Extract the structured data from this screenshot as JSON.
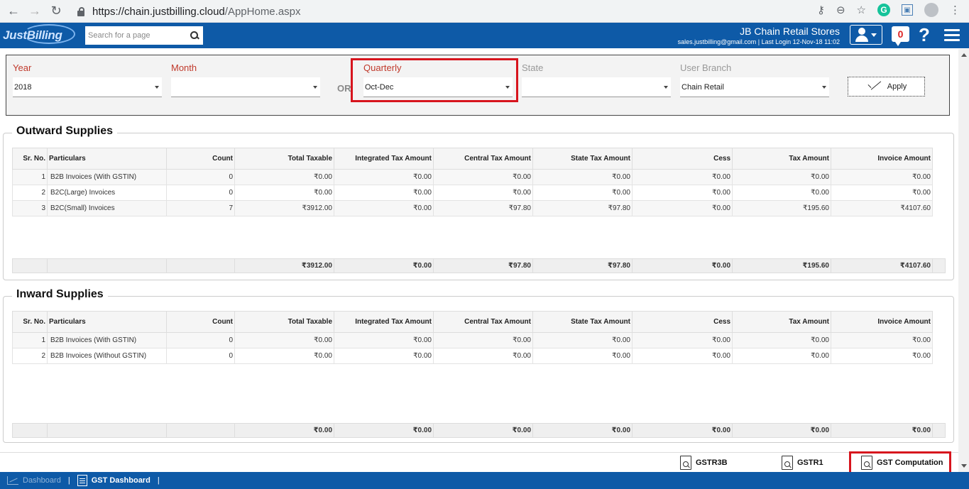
{
  "browser": {
    "url_host": "https://chain.justbilling.cloud",
    "url_path": "/AppHome.aspx"
  },
  "header": {
    "logo": "JustBilling",
    "search_placeholder": "Search for a page",
    "store_name": "JB Chain Retail Stores",
    "store_sub": "sales.justbilling@gmail.com | Last Login 12-Nov-18 11:02",
    "notification_count": "0",
    "help_label": "?"
  },
  "filters": {
    "year": {
      "label": "Year",
      "value": "2018"
    },
    "month": {
      "label": "Month",
      "value": ""
    },
    "or_label": "OR",
    "quarterly": {
      "label": "Quarterly",
      "value": "Oct-Dec"
    },
    "state": {
      "label": "State",
      "value": ""
    },
    "branch": {
      "label": "User Branch",
      "value": "Chain Retail"
    },
    "apply_label": "Apply"
  },
  "columns": [
    "Sr. No.",
    "Particulars",
    "Count",
    "Total Taxable",
    "Integrated Tax Amount",
    "Central Tax Amount",
    "State Tax Amount",
    "Cess",
    "Tax Amount",
    "Invoice Amount"
  ],
  "outward": {
    "title": "Outward Supplies",
    "rows": [
      [
        "1",
        "B2B Invoices (With GSTIN)",
        "0",
        "₹0.00",
        "₹0.00",
        "₹0.00",
        "₹0.00",
        "₹0.00",
        "₹0.00",
        "₹0.00"
      ],
      [
        "2",
        "B2C(Large) Invoices",
        "0",
        "₹0.00",
        "₹0.00",
        "₹0.00",
        "₹0.00",
        "₹0.00",
        "₹0.00",
        "₹0.00"
      ],
      [
        "3",
        "B2C(Small) Invoices",
        "7",
        "₹3912.00",
        "₹0.00",
        "₹97.80",
        "₹97.80",
        "₹0.00",
        "₹195.60",
        "₹4107.60"
      ]
    ],
    "totals": [
      "",
      "",
      "",
      "₹3912.00",
      "₹0.00",
      "₹97.80",
      "₹97.80",
      "₹0.00",
      "₹195.60",
      "₹4107.60"
    ]
  },
  "inward": {
    "title": "Inward Supplies",
    "rows": [
      [
        "1",
        "B2B Invoices (With GSTIN)",
        "0",
        "₹0.00",
        "₹0.00",
        "₹0.00",
        "₹0.00",
        "₹0.00",
        "₹0.00",
        "₹0.00"
      ],
      [
        "2",
        "B2B Invoices (Without GSTIN)",
        "0",
        "₹0.00",
        "₹0.00",
        "₹0.00",
        "₹0.00",
        "₹0.00",
        "₹0.00",
        "₹0.00"
      ]
    ],
    "totals": [
      "",
      "",
      "",
      "₹0.00",
      "₹0.00",
      "₹0.00",
      "₹0.00",
      "₹0.00",
      "₹0.00",
      "₹0.00"
    ]
  },
  "toolbar": {
    "gstr3b": "GSTR3B",
    "gstr1": "GSTR1",
    "gst_computation": "GST Computation"
  },
  "bottom_tabs": {
    "dashboard": "Dashboard",
    "gst_dashboard": "GST Dashboard"
  },
  "colors": {
    "brand_blue": "#0e5aa7",
    "highlight_red": "#d7141d",
    "label_red": "#c0392b"
  }
}
